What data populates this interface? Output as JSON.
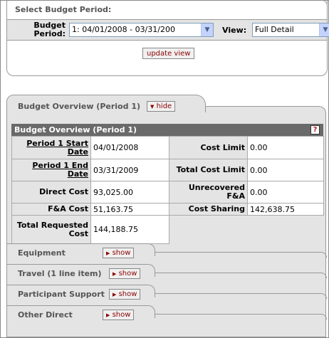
{
  "select": {
    "title": "Select Budget Period:",
    "budget_period_label": "Budget Period:",
    "budget_period_value": "1: 04/01/2008 - 03/31/200",
    "view_label": "View:",
    "view_value": "Full Detail",
    "update_label": "update view"
  },
  "overview": {
    "tab_title": "Budget Overview (Period 1)",
    "hide_label": "hide",
    "header": "Budget Overview (Period 1)",
    "help": "?",
    "rows": {
      "start_label": "Period 1 Start Date",
      "start_value": "04/01/2008",
      "cost_limit_label": "Cost Limit",
      "cost_limit_value": "0.00",
      "end_label": "Period 1 End Date",
      "end_value": "03/31/2009",
      "total_cost_limit_label": "Total Cost Limit",
      "total_cost_limit_value": "0.00",
      "direct_label": "Direct Cost",
      "direct_value": "93,025.00",
      "unrecovered_label": "Unrecovered F&A",
      "unrecovered_value": "0.00",
      "fa_label": "F&A Cost",
      "fa_value": "51,163.75",
      "cost_sharing_label": "Cost Sharing",
      "cost_sharing_value": "142,638.75",
      "total_label": "Total Requested Cost",
      "total_value": "144,188.75"
    }
  },
  "subtabs": [
    {
      "title": "Equipment",
      "show": "show"
    },
    {
      "title": "Travel (1 line item)",
      "show": "show"
    },
    {
      "title": "Participant Support",
      "show": "show"
    },
    {
      "title": "Other Direct",
      "show": "show"
    }
  ]
}
